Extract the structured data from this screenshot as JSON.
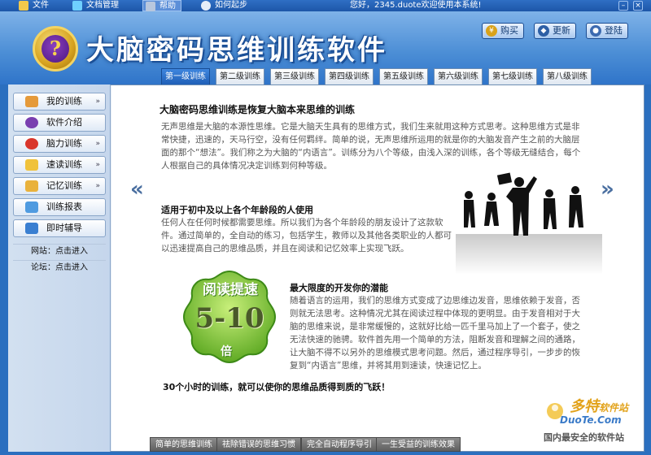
{
  "menubar": {
    "items": [
      {
        "label": "文件",
        "icon": "file-icon"
      },
      {
        "label": "文档管理",
        "icon": "document-icon"
      },
      {
        "label": "帮助",
        "icon": "help-icon"
      },
      {
        "label": "如何起步",
        "icon": "start-icon"
      }
    ],
    "welcome": "您好，2345.duote欢迎使用本系统!"
  },
  "header": {
    "title": "大脑密码思维训练软件",
    "buttons": [
      {
        "label": "购买",
        "icon": "cart-icon"
      },
      {
        "label": "更新",
        "icon": "shield-icon"
      },
      {
        "label": "登陆",
        "icon": "user-icon"
      }
    ]
  },
  "tabs": [
    "第一级训练",
    "第二级训练",
    "第三级训练",
    "第四级训练",
    "第五级训练",
    "第六级训练",
    "第七级训练",
    "第八级训练"
  ],
  "sidebar": {
    "items": [
      {
        "label": "我的训练",
        "chevron": "»"
      },
      {
        "label": "软件介绍",
        "chevron": ""
      },
      {
        "label": "脑力训练",
        "chevron": "»"
      },
      {
        "label": "速读训练",
        "chevron": "»"
      },
      {
        "label": "记忆训练",
        "chevron": "»"
      },
      {
        "label": "训练报表",
        "chevron": ""
      },
      {
        "label": "即时辅导",
        "chevron": ""
      }
    ],
    "links": [
      "网站：点击进入",
      "论坛：点击进入"
    ]
  },
  "content": {
    "heading": "大脑密码思维训练是恢复大脑本来思维的训练",
    "intro": "无声思维是大脑的本源性思维。它是大脑天生具有的思维方式，我们生来就用这种方式思考。这种思维方式是非常快捷，迅速的，天马行空，没有任何羁绊。简单的说，无声思维所运用的就是你的大脑发音产生之前的大脑层面的那个“想法”。我们称之为大脑的“内语言”。训练分为八个等级，由浅入深的训练，各个等级无缝结合，每个人根据自己的具体情况决定训练到何种等级。",
    "audience_title": "适用于初中及以上各个年龄段的人使用",
    "audience_text": "任何人在任何时候都需要思维。所以我们为各个年龄段的朋友设计了这款软件。通过简单的，全自动的练习，包括学生，教师以及其他各类职业的人都可以迅速提高自己的思维品质，并且在阅读和记忆效率上实现飞跃。",
    "potential_title": "最大限度的开发你的潜能",
    "potential_text": "随着语言的运用，我们的思维方式变成了边思维边发音，思维依赖于发音，否则就无法思考。这种情况尤其在阅读过程中体现的更明显。由于发音相对于大脑的思维来说，是非常缓慢的，这就好比给一匹千里马加上了一个套子，使之无法快速的驰骋。软件首先用一个简单的方法，阻断发音和理解之间的通路，让大脑不得不以另外的思维模式思考问题。然后，通过程序导引，一步步的恢复到“内语言”思维，并将其用到速读，快速记忆上。",
    "closing": "30个小时的训练，就可以使你的思维品质得到质的飞跃！",
    "badge": {
      "label": "阅读提速",
      "number": "5-10",
      "unit": "倍"
    }
  },
  "bottom_buttons": [
    "简单的思维训练",
    "祛除错误的思维习惯",
    "完全自动程序导引",
    "一生受益的训练效果"
  ],
  "watermark": {
    "brand": "多特",
    "brand_sub": "软件站",
    "domain": "DuoTe.Com",
    "caption": "国内最安全的软件站"
  }
}
